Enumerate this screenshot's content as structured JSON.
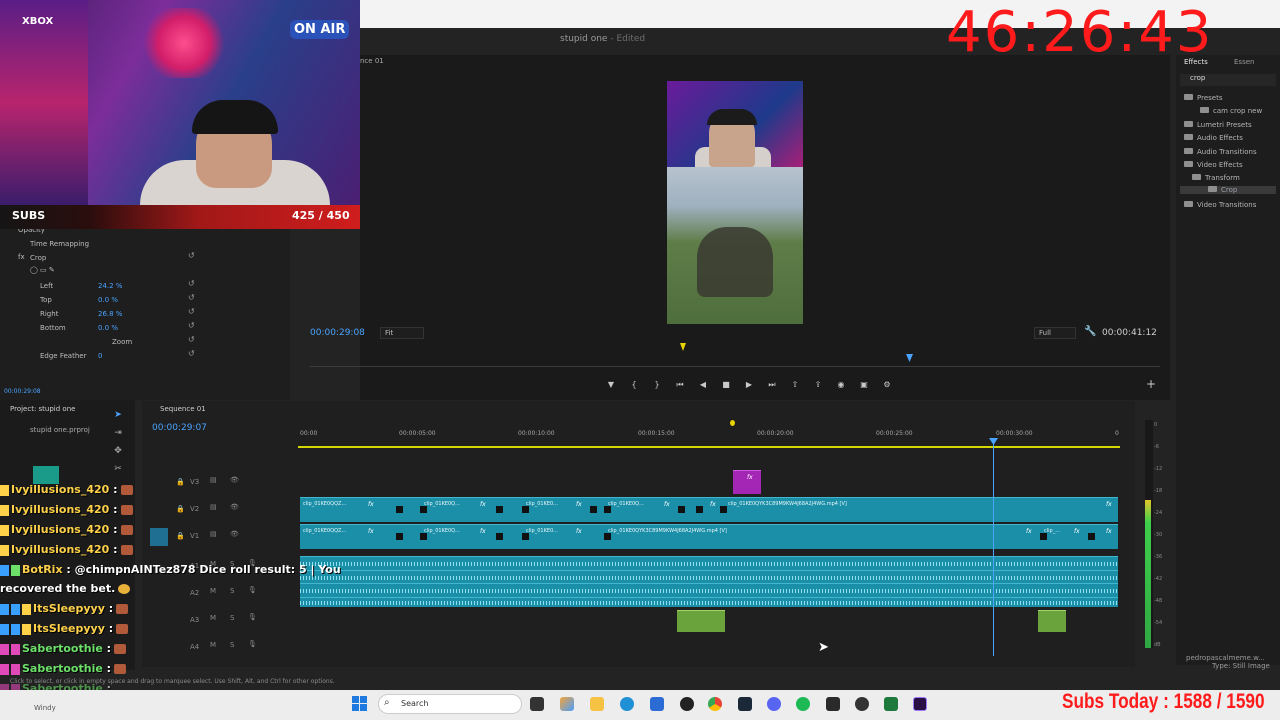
{
  "app": {
    "doc_title": "stupid one",
    "doc_status": " - Edited"
  },
  "program": {
    "sequence_tab": "nce 01",
    "timecode_left": "00:00:29:08",
    "fit": "Fit",
    "resolution": "Full",
    "timecode_right": "00:00:41:12"
  },
  "effect_controls": {
    "rows": [
      {
        "label": "Opacity"
      },
      {
        "label": "Time Remapping"
      },
      {
        "label": "Crop"
      },
      {
        "label": "Left",
        "value": "24.2 %"
      },
      {
        "label": "Top",
        "value": "0.0 %"
      },
      {
        "label": "Right",
        "value": "26.8 %"
      },
      {
        "label": "Bottom",
        "value": "0.0 %"
      },
      {
        "label": "Zoom"
      },
      {
        "label": "Edge Feather",
        "value": "0"
      }
    ],
    "fx_symbol": "fx",
    "time": "00:00:29:08"
  },
  "effects": {
    "tabs": [
      "Effects",
      "Essen"
    ],
    "search_value": "crop",
    "tree": [
      {
        "label": "Presets"
      },
      {
        "label": "cam crop new"
      },
      {
        "label": "Lumetri Presets"
      },
      {
        "label": "Audio Effects"
      },
      {
        "label": "Audio Transitions"
      },
      {
        "label": "Video Effects"
      },
      {
        "label": "Transform"
      },
      {
        "label": "Crop"
      },
      {
        "label": "Video Transitions"
      }
    ],
    "footer_user": "pedropascalmeme.w...",
    "footer_type": "Type: Still Image"
  },
  "project": {
    "tab": "Project: stupid one",
    "file": "stupid one.prproj"
  },
  "timeline": {
    "tab": "Sequence 01",
    "timecode": "00:00:29:07",
    "ticks": [
      "00:00",
      "00:00:05:00",
      "00:00:10:00",
      "00:00:15:00",
      "00:00:20:00",
      "00:00:25:00",
      "00:00:30:00",
      "0"
    ],
    "tracks": [
      "V3",
      "V2",
      "V1",
      "A1",
      "A2",
      "A3",
      "A4"
    ],
    "clip_short_a": "clip_01KE0QQZ...",
    "clip_short_b": "clip_01KE0Q...",
    "clip_short_c": "clip_01KE0...",
    "clip_long_v2": "clip_01KE0QYK3C89M9KW4J68A2J4WG.mp4 [V]",
    "clip_long_v1": "clip_01KE0QYK3C89M9KW4J68A2J4WG.mp4 [V]",
    "clip_end": "clip_...",
    "fx": "fx",
    "status_hint": "Click to select, or click in empty space and drag to marquee select. Use Shift, Alt, and Ctrl for other options.",
    "meter_labels": [
      "0",
      "-6",
      "-12",
      "-18",
      "-24",
      "-30",
      "-36",
      "-42",
      "-48",
      "-54",
      "dB"
    ]
  },
  "stream": {
    "big_timer": "46:26:43",
    "subs_label": "SUBS",
    "subs_count": "425 / 450",
    "on_air": "ON AIR",
    "xbox": "XBOX",
    "subs_today": "Subs Today : 1588 / 1590"
  },
  "chat": [
    {
      "user": "Ivyillusions_420",
      "message": ":",
      "badge_color": "#ffd24a"
    },
    {
      "user": "Ivyillusions_420",
      "message": ":",
      "badge_color": "#ffd24a"
    },
    {
      "user": "Ivyillusions_420",
      "message": ":",
      "badge_color": "#ffd24a"
    },
    {
      "user": "Ivyillusions_420",
      "message": ":",
      "badge_color": "#ffd24a"
    },
    {
      "user": "BotRix",
      "message": ": @chimpnAINTez878 Dice roll result: 5 | You",
      "badge_color": "#3aa0ff",
      "user_color": "#ffd24a"
    },
    {
      "user": "",
      "message": "recovered the bet.",
      "badge_color": ""
    },
    {
      "user": "ItsSleepyyy",
      "message": ":",
      "badge_color": "#3aa0ff"
    },
    {
      "user": "ItsSleepyyy",
      "message": ":",
      "badge_color": "#3aa0ff"
    },
    {
      "user": "Sabertoothie",
      "message": ":",
      "badge_color": "#e04ab8",
      "user_color": "#6de06a"
    },
    {
      "user": "Sabertoothie",
      "message": ":",
      "badge_color": "#e04ab8",
      "user_color": "#6de06a"
    },
    {
      "user": "Sabertoothie",
      "message": ":",
      "badge_color": "#e04ab8",
      "user_color": "#6de06a"
    }
  ],
  "taskbar": {
    "weather": "Windy",
    "search_placeholder": "Search"
  }
}
